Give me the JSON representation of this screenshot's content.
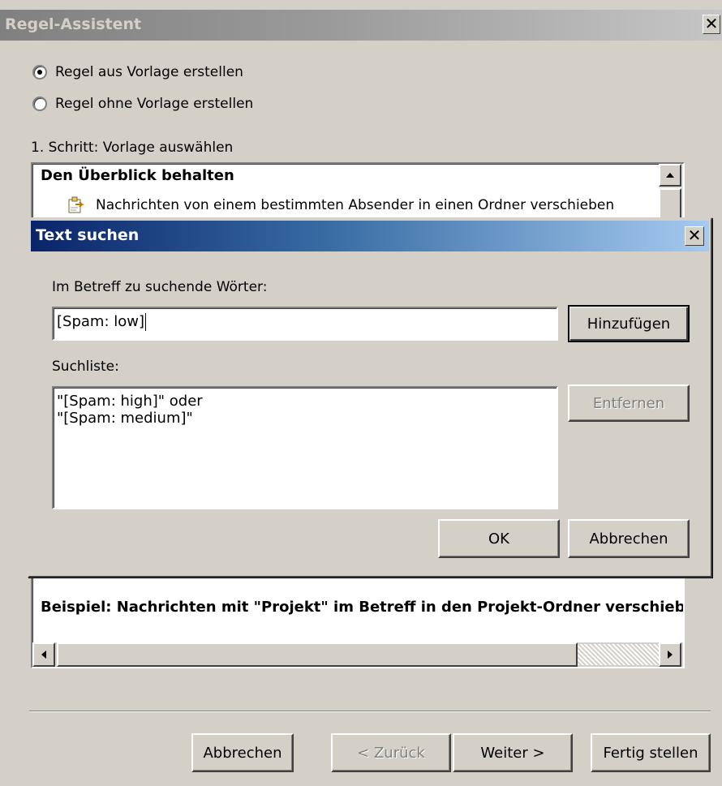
{
  "wizard": {
    "title": "Regel-Assistent",
    "close_glyph": "✕",
    "radio_options": [
      {
        "label": "Regel aus Vorlage erstellen",
        "selected": true
      },
      {
        "label": "Regel ohne Vorlage erstellen",
        "selected": false
      }
    ],
    "step_label": "1. Schritt: Vorlage auswählen",
    "template_list": {
      "group_header": "Den Überblick behalten",
      "items": [
        "Nachrichten von einem bestimmten Absender in einen Ordner verschieben"
      ],
      "item_icon": "rule-template-icon"
    },
    "description": "Beispiel: Nachrichten mit \"Projekt\" im Betreff in den Projekt-Ordner verschieben",
    "buttons": {
      "cancel": "Abbrechen",
      "back": "< Zurück",
      "next": "Weiter >",
      "finish": "Fertig stellen"
    }
  },
  "dialog": {
    "title": "Text suchen",
    "close_glyph": "✕",
    "input_label": "Im Betreff zu suchende Wörter:",
    "input_value": "[Spam: low]",
    "add_button": "Hinzufügen",
    "list_label": "Suchliste:",
    "search_list": [
      "\"[Spam: high]\" oder",
      "\"[Spam: medium]\""
    ],
    "remove_button": "Entfernen",
    "ok_button": "OK",
    "cancel_button": "Abbrechen"
  },
  "colors": {
    "face": "#d4d0c8",
    "active_title_start": "#0a246a",
    "active_title_end": "#a6caf0",
    "inactive_title": "#808080"
  }
}
